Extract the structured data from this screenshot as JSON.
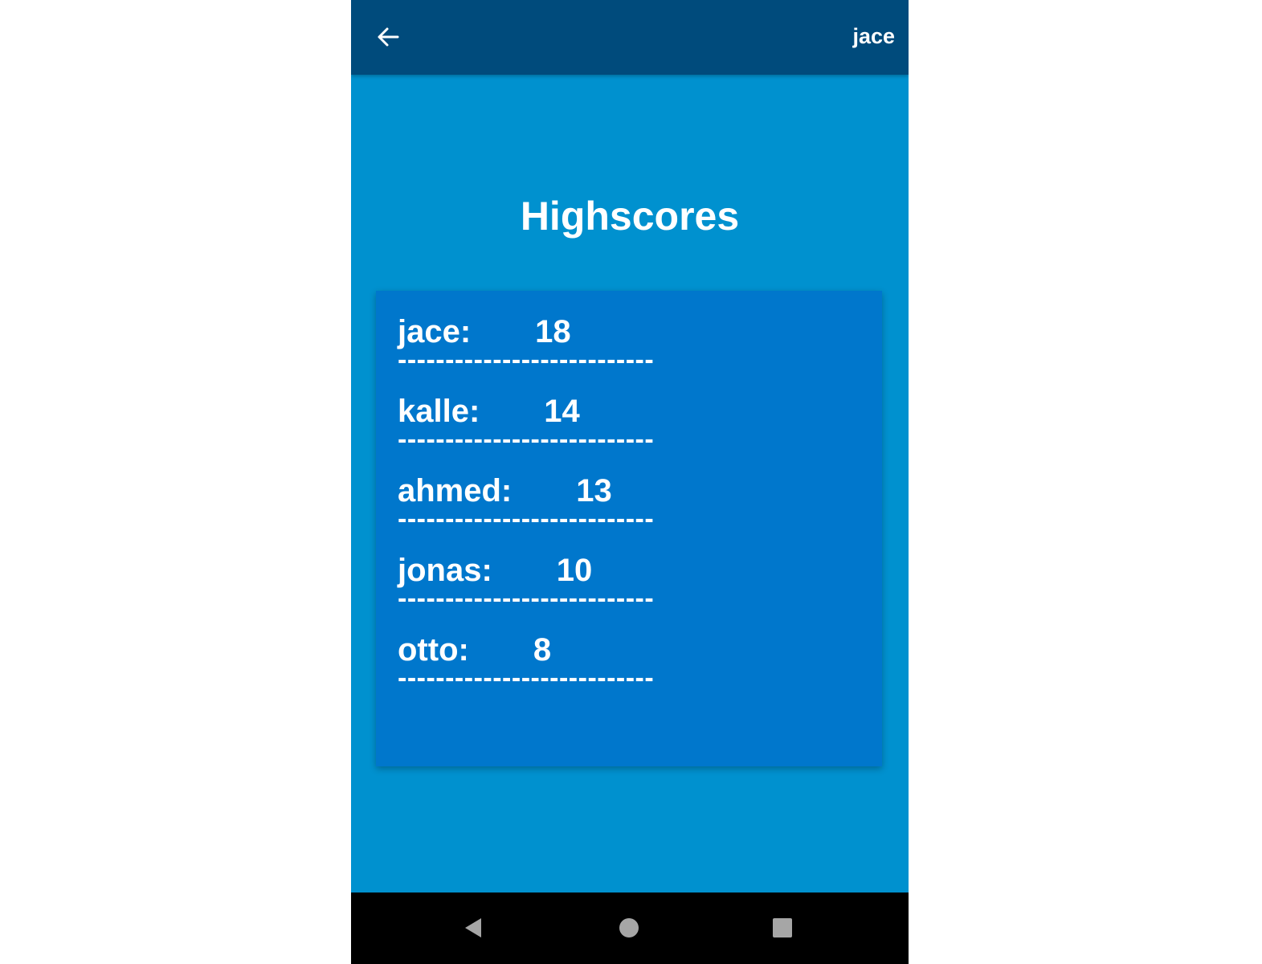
{
  "topbar": {
    "back_icon": "arrow-left-icon",
    "username": "jace"
  },
  "main": {
    "title": "Highscores",
    "scores": [
      {
        "name": "jace:",
        "score": "18"
      },
      {
        "name": "kalle:",
        "score": "14"
      },
      {
        "name": "ahmed:",
        "score": "13"
      },
      {
        "name": "jonas:",
        "score": "10"
      },
      {
        "name": "otto:",
        "score": "8"
      }
    ],
    "divider": "---------------------------"
  },
  "navbar": {
    "back_icon": "triangle-back-icon",
    "home_icon": "circle-home-icon",
    "recents_icon": "square-recents-icon"
  },
  "colors": {
    "topbar": "#004b7c",
    "background": "#0091cf",
    "card": "#0077cc",
    "text": "#ffffff",
    "navbar": "#000000"
  }
}
